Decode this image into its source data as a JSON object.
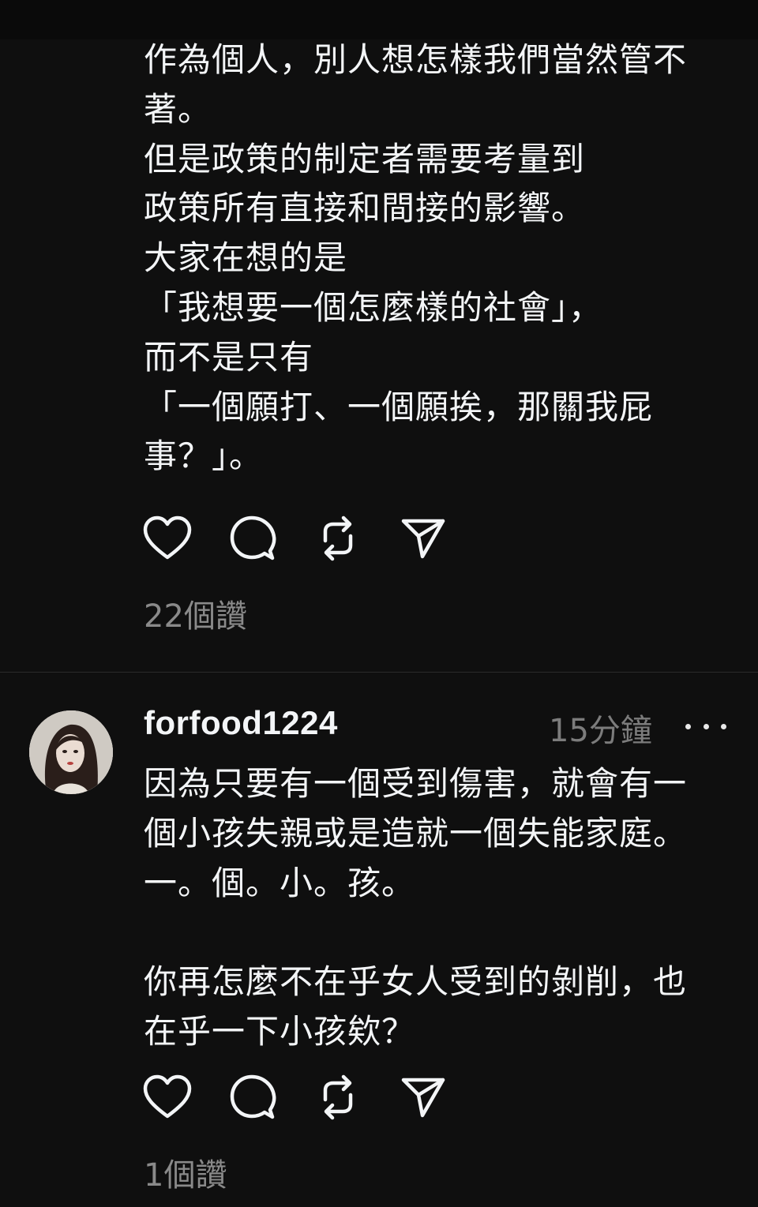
{
  "post1": {
    "lines": [
      "作為個人，別人想怎樣我們當然管不",
      "著。",
      "但是政策的制定者需要考量到",
      "政策所有直接和間接的影響。",
      "大家在想的是",
      "「我想要一個怎麼樣的社會」，",
      "而不是只有",
      "「一個願打、一個願挨，那關我屁",
      "事？」。"
    ],
    "likes": "22個讚"
  },
  "reply": {
    "username": "forfood1224",
    "time": "15分鐘",
    "lines": [
      "因為只要有一個受到傷害，就會有一",
      "個小孩失親或是造就一個失能家庭。",
      "一。個。小。孩。",
      "",
      "你再怎麼不在乎女人受到的剝削，也",
      "在乎一下小孩欸？"
    ],
    "likes": "1個讚"
  },
  "icons": {
    "like": "heart-icon",
    "comment": "comment-icon",
    "repost": "repost-icon",
    "share": "share-icon",
    "more": "more-icon"
  },
  "colors": {
    "background": "#0f0f0f",
    "text": "#f3f5f7",
    "secondary": "#8a8a8a"
  }
}
